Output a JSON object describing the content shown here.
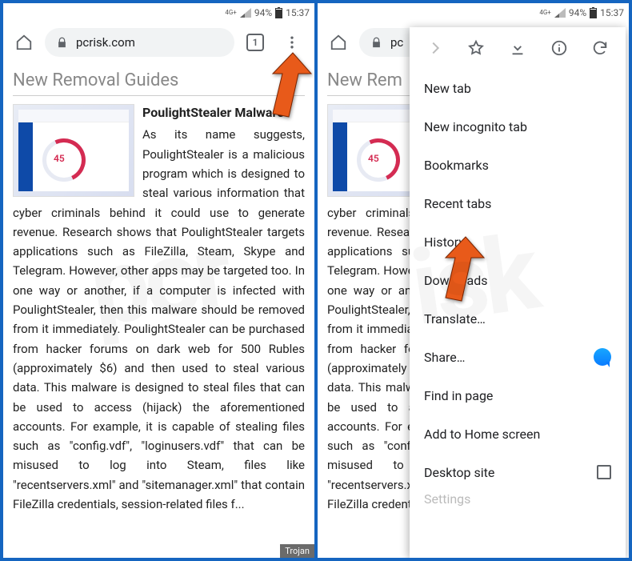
{
  "status": {
    "network": "4G+",
    "battery_pct": "94%",
    "time": "15:37"
  },
  "toolbar": {
    "host": "pcrisk.com",
    "host_truncated": "pc",
    "tab_count": "1"
  },
  "page": {
    "section_title": "New Removal Guides",
    "section_title_truncated": "New Rem",
    "article_title": "PoulightStealer Malware",
    "article_body": "As its name suggests, PoulightStealer is a malicious program which is designed to steal various information that cyber criminals behind it could use to generate revenue. Research shows that PoulightStealer targets applications such as FileZilla, Steam, Skype and Telegram. However, other apps may be targeted too. In one way or another, if a computer is infected with PoulightStealer, then this malware should be removed from it immediately. PoulightStealer can be purchased from hacker forums on dark web for 500 Rubles (approximately $6) and then used to steal various data. This malware is designed to steal files that can be used to access (hijack) the aforementioned accounts. For example, it is capable of stealing files such as \"config.vdf\", \"loginusers.vdf\" that can be misused to log into Steam, files like \"recentservers.xml\" and \"sitemanager.xml\" that contain FileZilla credentials, session-related files f...",
    "thumb_score": "45",
    "tag": "Trojan"
  },
  "menu": {
    "items": [
      "New tab",
      "New incognito tab",
      "Bookmarks",
      "Recent tabs",
      "History",
      "Downloads",
      "Translate…",
      "Share…",
      "Find in page",
      "Add to Home screen",
      "Desktop site"
    ],
    "cutoff": "Settings"
  },
  "chart_data": {
    "type": "gauge-thumbnail",
    "value": 45,
    "max": 70,
    "note": "small gauge graphic inside article thumbnail; approximate reading"
  }
}
